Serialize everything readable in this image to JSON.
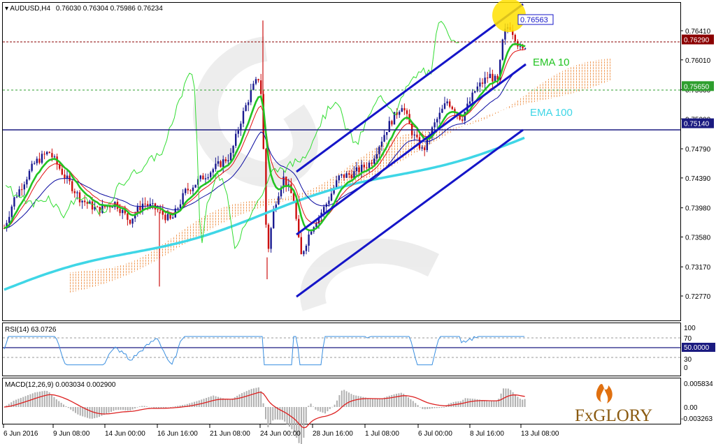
{
  "header": {
    "symbol_label": "AUDUSD,H4",
    "ohlc": "0.76030 0.76304 0.75986 0.76234"
  },
  "annotations": {
    "peak_label": "0.76563",
    "ema10_label": "EMA 10",
    "ema100_label": "EMA 100"
  },
  "price_axis": {
    "ticks": [
      "0.76410",
      "0.76010",
      "0.75600",
      "0.75200",
      "0.74790",
      "0.74390",
      "0.73980",
      "0.73580",
      "0.73170",
      "0.72770"
    ],
    "tags": [
      {
        "text": "0.76290",
        "color": "#8b0000",
        "value": 0.7629
      },
      {
        "text": "0.75650",
        "color": "#2e9e2e",
        "value": 0.7565
      },
      {
        "text": "0.75140",
        "color": "#1a1a80",
        "value": 0.7514
      }
    ]
  },
  "rsi_panel": {
    "label": "RSI(14) 63.0726",
    "ticks": [
      "100",
      "70",
      "30",
      "0"
    ],
    "tag": "50.0000"
  },
  "macd_panel": {
    "label": "MACD(12,26,9) 0.003034 0.002900",
    "ticks": [
      "0.005834",
      "0.00",
      "-0.003263"
    ]
  },
  "time_axis": [
    "6 Jun 2016",
    "9 Jun 08:00",
    "14 Jun 00:00",
    "16 Jun 16:00",
    "21 Jun 08:00",
    "24 Jun 00:00",
    "28 Jun 16:00",
    "1 Jul 08:00",
    "6 Jul 00:00",
    "8 Jul 16:00",
    "13 Jul 08:00"
  ],
  "logo": {
    "text": "FxGLORY"
  },
  "colors": {
    "ema10": "#22c422",
    "ema100": "#3fd6e6",
    "channel": "#1515c8",
    "tenkan": "#e01010",
    "kijun": "#0a0aa0",
    "chikou": "#33dd33",
    "kumo": "#f0a060",
    "rsi": "#3a8fe0",
    "macd_signal": "#dd2020",
    "macd_hist": "#b0b0b0",
    "bull": "#1a1a90",
    "bear": "#cc1010",
    "highlight": "#ffe000"
  },
  "chart_data": [
    {
      "type": "candlestick",
      "title": "AUDUSD,H4",
      "y_range": [
        0.7277,
        0.7641
      ],
      "key_values": {
        "last_close": 0.76234,
        "marked_high": 0.76563,
        "resistance": 0.7629,
        "support_1": 0.7565,
        "support_2": 0.7514
      },
      "indicators": [
        "EMA 10",
        "EMA 100",
        "Ichimoku",
        "Rising channel"
      ],
      "x_labels": [
        "6 Jun 2016",
        "9 Jun 08:00",
        "14 Jun 00:00",
        "16 Jun 16:00",
        "21 Jun 08:00",
        "24 Jun 00:00",
        "28 Jun 16:00",
        "1 Jul 08:00",
        "6 Jul 00:00",
        "8 Jul 16:00",
        "13 Jul 08:00"
      ]
    },
    {
      "type": "line",
      "title": "RSI(14)",
      "current": 63.0726,
      "levels": [
        30,
        50,
        70
      ],
      "y_range": [
        0,
        100
      ]
    },
    {
      "type": "bar",
      "title": "MACD(12,26,9)",
      "main": 0.003034,
      "signal": 0.0029,
      "y_range": [
        -0.003263,
        0.005834
      ]
    }
  ]
}
